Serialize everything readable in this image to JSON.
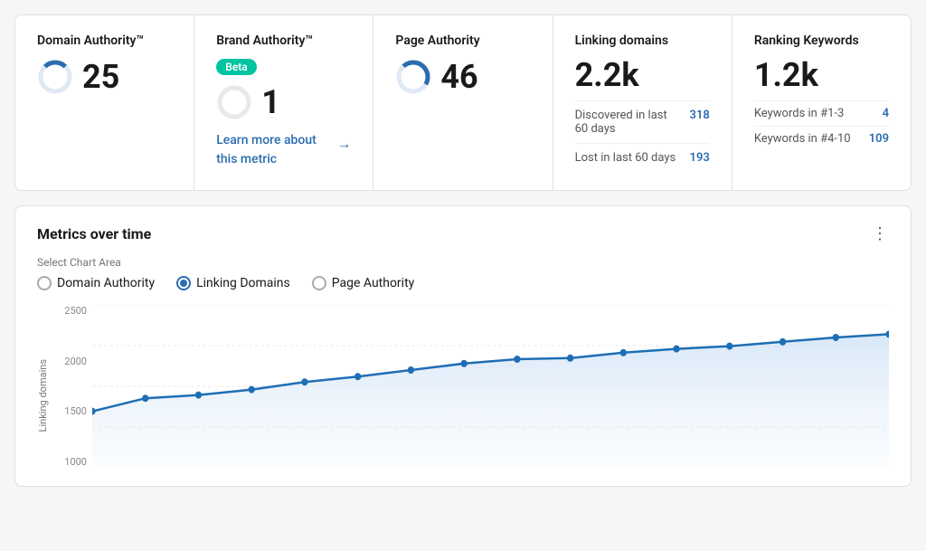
{
  "cards": {
    "domain_authority": {
      "title": "Domain Authority™",
      "value": "25",
      "donut_color": "#2b6cb0",
      "donut_bg": "#e0e8f5",
      "donut_percent": 25
    },
    "brand_authority": {
      "title": "Brand Authority™",
      "beta_label": "Beta",
      "value": "1",
      "learn_more": "Learn more about this metric",
      "arrow": "→"
    },
    "page_authority": {
      "title": "Page Authority",
      "value": "46",
      "donut_percent": 46
    },
    "linking_domains": {
      "title": "Linking domains",
      "value": "2.2k",
      "rows": [
        {
          "label": "Discovered in last 60 days",
          "value": "318"
        },
        {
          "label": "Lost in last 60 days",
          "value": "193"
        }
      ]
    },
    "ranking_keywords": {
      "title": "Ranking Keywords",
      "value": "1.2k",
      "rows": [
        {
          "label": "Keywords in #1-3",
          "value": "4"
        },
        {
          "label": "Keywords in #4-10",
          "value": "109"
        }
      ]
    }
  },
  "metrics": {
    "section_title": "Metrics over time",
    "chart_area_label": "Select Chart Area",
    "radio_options": [
      {
        "label": "Domain Authority",
        "selected": false
      },
      {
        "label": "Linking Domains",
        "selected": true
      },
      {
        "label": "Page Authority",
        "selected": false
      }
    ],
    "y_axis_label": "Linking domains",
    "y_ticks": [
      "2500",
      "2000",
      "1500",
      "1000"
    ],
    "dots_icon": "⋮"
  }
}
